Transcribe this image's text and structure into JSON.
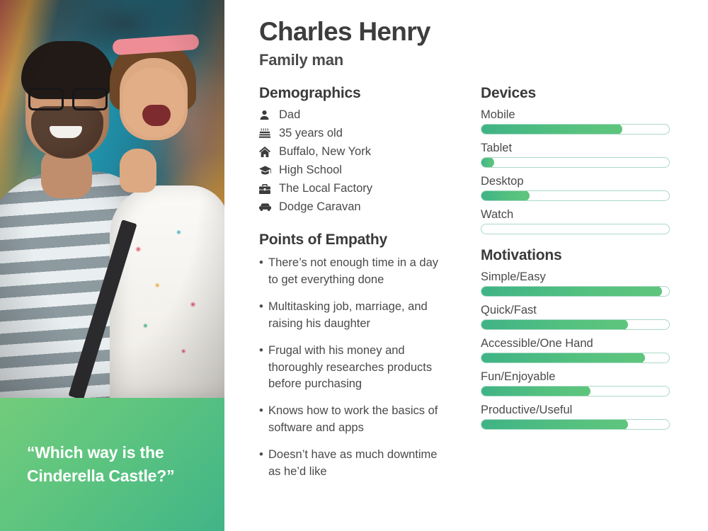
{
  "persona": {
    "name": "Charles Henry",
    "role": "Family man",
    "quote": "“Which way is the Cinderella Castle?”",
    "photo_alt": "Man holding smiling young girl at outdoor event"
  },
  "demographics": {
    "title": "Demographics",
    "items": [
      {
        "icon": "user-icon",
        "label": "Dad"
      },
      {
        "icon": "birthday-cake-icon",
        "label": "35 years old"
      },
      {
        "icon": "home-icon",
        "label": "Buffalo, New York"
      },
      {
        "icon": "graduation-cap-icon",
        "label": "High School"
      },
      {
        "icon": "briefcase-icon",
        "label": "The Local Factory"
      },
      {
        "icon": "car-icon",
        "label": "Dodge Caravan"
      }
    ]
  },
  "empathy": {
    "title": "Points of Empathy",
    "items": [
      "There’s not enough time in a day to get everything done",
      "Multitasking job, marriage, and raising his daughter",
      "Frugal with his money and thoroughly researches products before purchasing",
      "Knows how to work the basics of software and apps",
      "Doesn’t have as much downtime as he’d like"
    ]
  },
  "devices": {
    "title": "Devices",
    "items": [
      {
        "label": "Mobile",
        "value": 75
      },
      {
        "label": "Tablet",
        "value": 7
      },
      {
        "label": "Desktop",
        "value": 26
      },
      {
        "label": "Watch",
        "value": 0
      }
    ]
  },
  "motivations": {
    "title": "Motivations",
    "items": [
      {
        "label": "Simple/Easy",
        "value": 96
      },
      {
        "label": "Quick/Fast",
        "value": 78
      },
      {
        "label": "Accessible/One Hand",
        "value": 87
      },
      {
        "label": "Fun/Enjoyable",
        "value": 58
      },
      {
        "label": "Productive/Useful",
        "value": 78
      }
    ]
  },
  "chart_data": {
    "type": "bar",
    "title": "Devices and Motivations ratings",
    "xlabel": "",
    "ylabel": "",
    "xlim": [
      0,
      100
    ],
    "grid": false,
    "legend": "none",
    "orientation": "horizontal",
    "groups": [
      {
        "name": "Devices",
        "categories": [
          "Mobile",
          "Tablet",
          "Desktop",
          "Watch"
        ],
        "values": [
          75,
          7,
          26,
          0
        ]
      },
      {
        "name": "Motivations",
        "categories": [
          "Simple/Easy",
          "Quick/Fast",
          "Accessible/One Hand",
          "Fun/Enjoyable",
          "Productive/Useful"
        ],
        "values": [
          96,
          78,
          87,
          58,
          78
        ]
      }
    ]
  },
  "colors": {
    "bar_fill_start": "#3fb386",
    "bar_fill_end": "#5ec57c",
    "bar_track_border": "#a9d9c6",
    "quote_gradient_start": "#72cc7c",
    "quote_gradient_end": "#41b487",
    "heading": "#3a3a3a",
    "body_text": "#4a4a4a",
    "background": "#ffffff"
  }
}
